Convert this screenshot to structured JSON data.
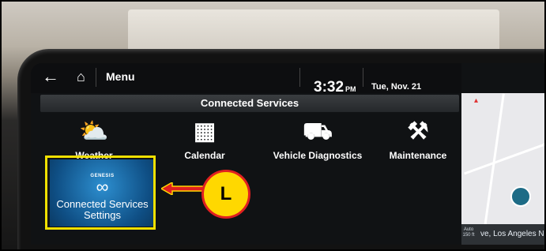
{
  "statusbar": {
    "menu_label": "Menu",
    "time": "3:32",
    "ampm": "PM",
    "date": "Tue, Nov. 21"
  },
  "screen": {
    "title": "Connected Services"
  },
  "tiles": [
    {
      "label": "Weather",
      "icon": "weather-icon"
    },
    {
      "label": "Calendar",
      "icon": "calendar-icon"
    },
    {
      "label": "Vehicle Diagnostics",
      "icon": "car-icon"
    },
    {
      "label": "Maintenance",
      "icon": "tools-icon"
    }
  ],
  "connected_settings": {
    "brand": "GENESIS",
    "label": "Connected Services Settings",
    "icon": "link-gear-icon"
  },
  "map": {
    "scale": "Auto 150 ft",
    "location": "ve, Los Angeles",
    "location_tail": "N"
  },
  "callout": {
    "letter": "L"
  },
  "colors": {
    "highlight": "#f0e000",
    "callout_fill": "#ffd800",
    "callout_border": "#e02020"
  }
}
